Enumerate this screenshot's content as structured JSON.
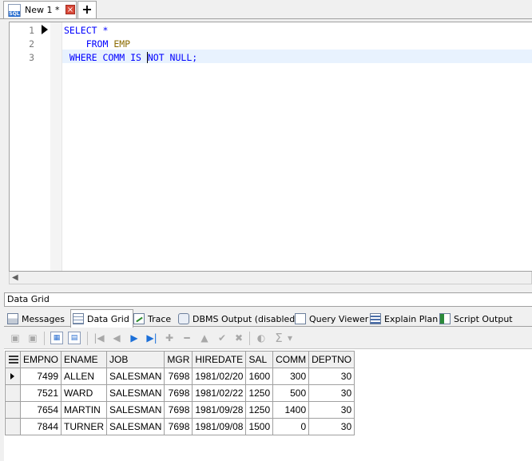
{
  "tabs": {
    "doc_tab_label": "New 1 *",
    "close_glyph": "×",
    "new_tab_glyph": "+"
  },
  "editor": {
    "line_numbers": [
      "1",
      "2",
      "3"
    ],
    "lines": [
      {
        "parts": [
          {
            "t": "SELECT *",
            "c": "kw"
          }
        ]
      },
      {
        "parts": [
          {
            "t": "    FROM ",
            "c": "kw"
          },
          {
            "t": "EMP",
            "c": "tbl"
          }
        ]
      },
      {
        "parts": [
          {
            "t": " WHERE COMM IS ",
            "c": "kw"
          },
          {
            "t": "|",
            "c": "caret"
          },
          {
            "t": "NOT NULL;",
            "c": "kw"
          }
        ]
      }
    ],
    "colors": {
      "keyword": "#0000ff",
      "table": "#8b6b00",
      "current_line": "#e8f2fe"
    }
  },
  "results": {
    "panel_title": "Data Grid",
    "tabs": [
      {
        "label": "Messages",
        "icon": "messages-icon"
      },
      {
        "label": "Data Grid",
        "icon": "data-grid-icon",
        "active": true
      },
      {
        "label": "Trace",
        "icon": "trace-icon"
      },
      {
        "label": "DBMS Output (disabled)",
        "icon": "dbms-output-icon"
      },
      {
        "label": "Query Viewer",
        "icon": "query-viewer-icon"
      },
      {
        "label": "Explain Plan",
        "icon": "explain-plan-icon"
      },
      {
        "label": "Script Output",
        "icon": "script-output-icon"
      }
    ],
    "toolbar": {
      "first": "|◀",
      "prev": "◀",
      "next": "▶",
      "last": "▶|",
      "add": "✚",
      "delete": "━",
      "up": "▲",
      "post": "✔",
      "cancel": "✖",
      "sum": "Σ",
      "dropdown": "▾"
    },
    "grid": {
      "columns": [
        "EMPNO",
        "ENAME",
        "JOB",
        "MGR",
        "HIREDATE",
        "SAL",
        "COMM",
        "DEPTNO"
      ],
      "rows": [
        [
          "7499",
          "ALLEN",
          "SALESMAN",
          "7698",
          "1981/02/20",
          "1600",
          "300",
          "30"
        ],
        [
          "7521",
          "WARD",
          "SALESMAN",
          "7698",
          "1981/02/22",
          "1250",
          "500",
          "30"
        ],
        [
          "7654",
          "MARTIN",
          "SALESMAN",
          "7698",
          "1981/09/28",
          "1250",
          "1400",
          "30"
        ],
        [
          "7844",
          "TURNER",
          "SALESMAN",
          "7698",
          "1981/09/08",
          "1500",
          "0",
          "30"
        ]
      ],
      "numeric_columns": [
        0,
        3,
        5,
        6,
        7
      ],
      "current_row": 0
    }
  }
}
